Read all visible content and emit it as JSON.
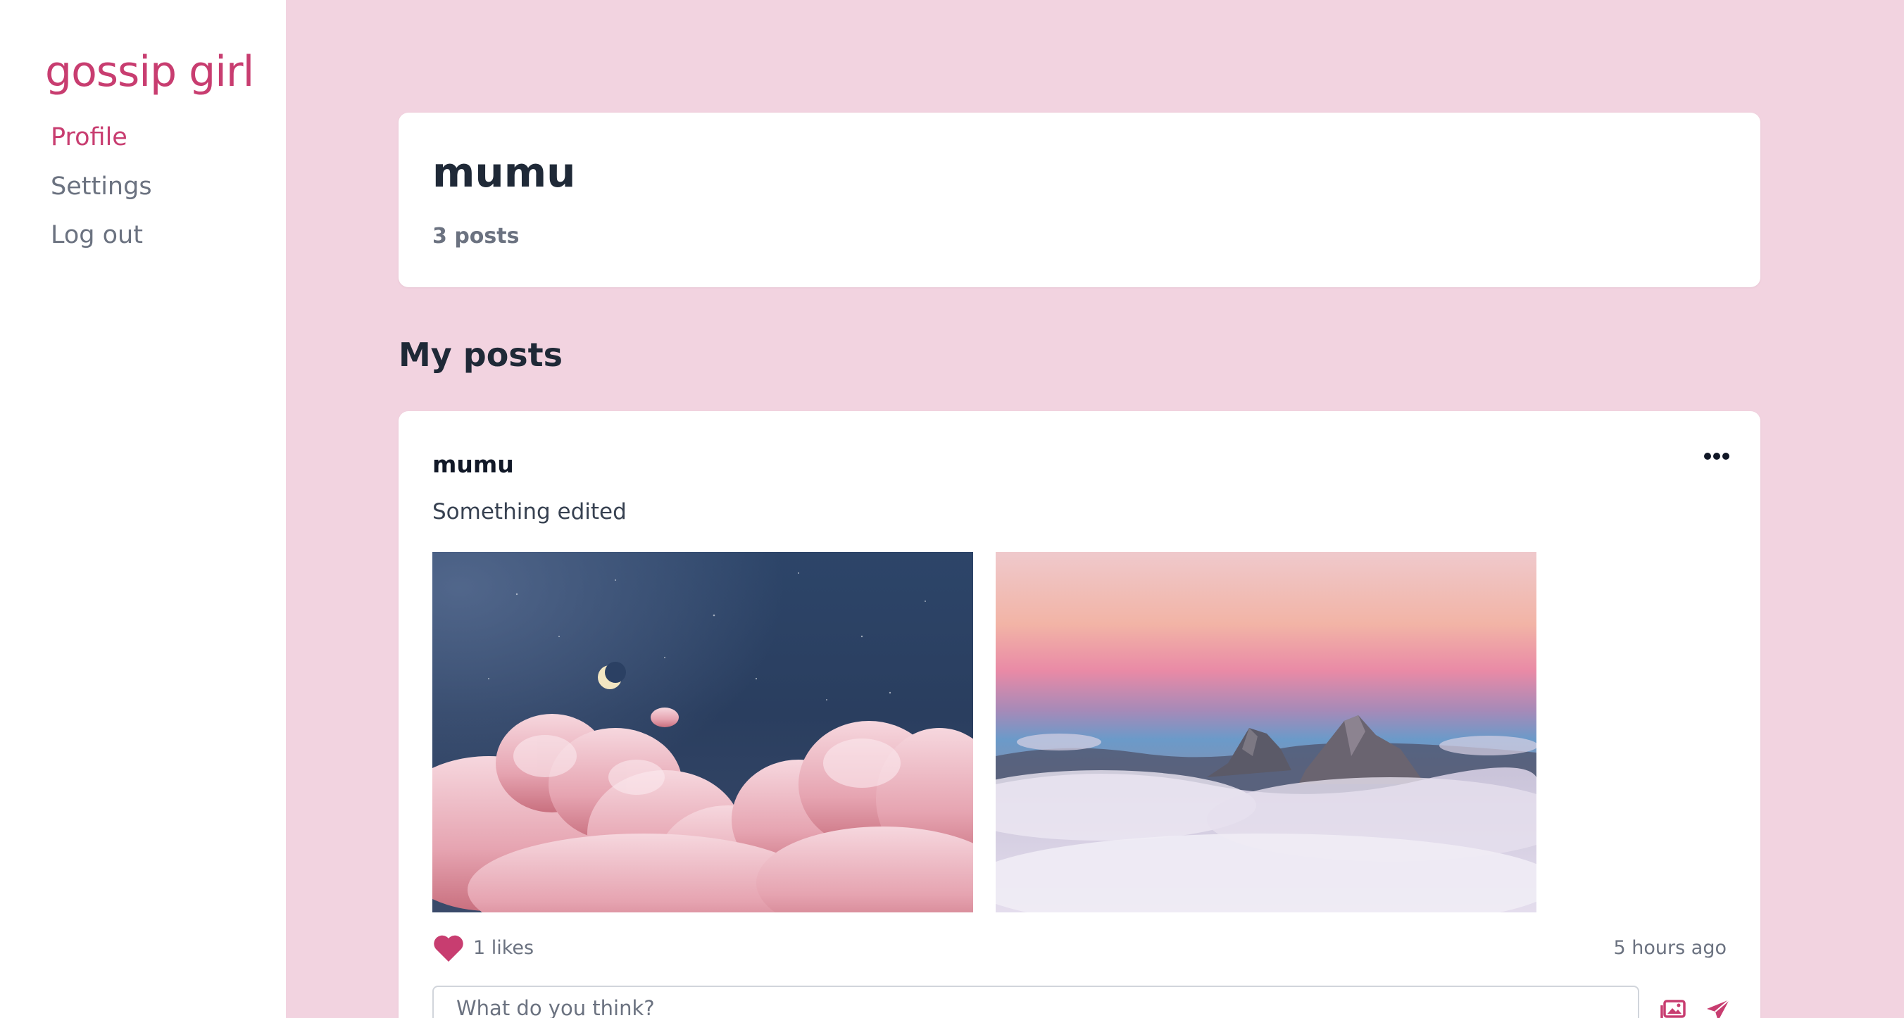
{
  "sidebar": {
    "brand": "gossip girl",
    "items": [
      {
        "label": "Profile",
        "active": true
      },
      {
        "label": "Settings",
        "active": false
      },
      {
        "label": "Log out",
        "active": false
      }
    ]
  },
  "profile": {
    "name": "mumu",
    "posts_count": "3 posts"
  },
  "section_title": "My posts",
  "post": {
    "author": "mumu",
    "text": "Something edited",
    "images": [
      "night-sky-pink-clouds",
      "mountain-peaks-above-clouds"
    ],
    "likes": "1 likes",
    "time": "5 hours ago",
    "comment_placeholder": "What do you think?"
  },
  "colors": {
    "accent": "#c83d70",
    "background": "#f2d3e0",
    "card": "#ffffff"
  },
  "icons": [
    "more-icon",
    "heart-icon",
    "image-icon",
    "send-icon"
  ]
}
